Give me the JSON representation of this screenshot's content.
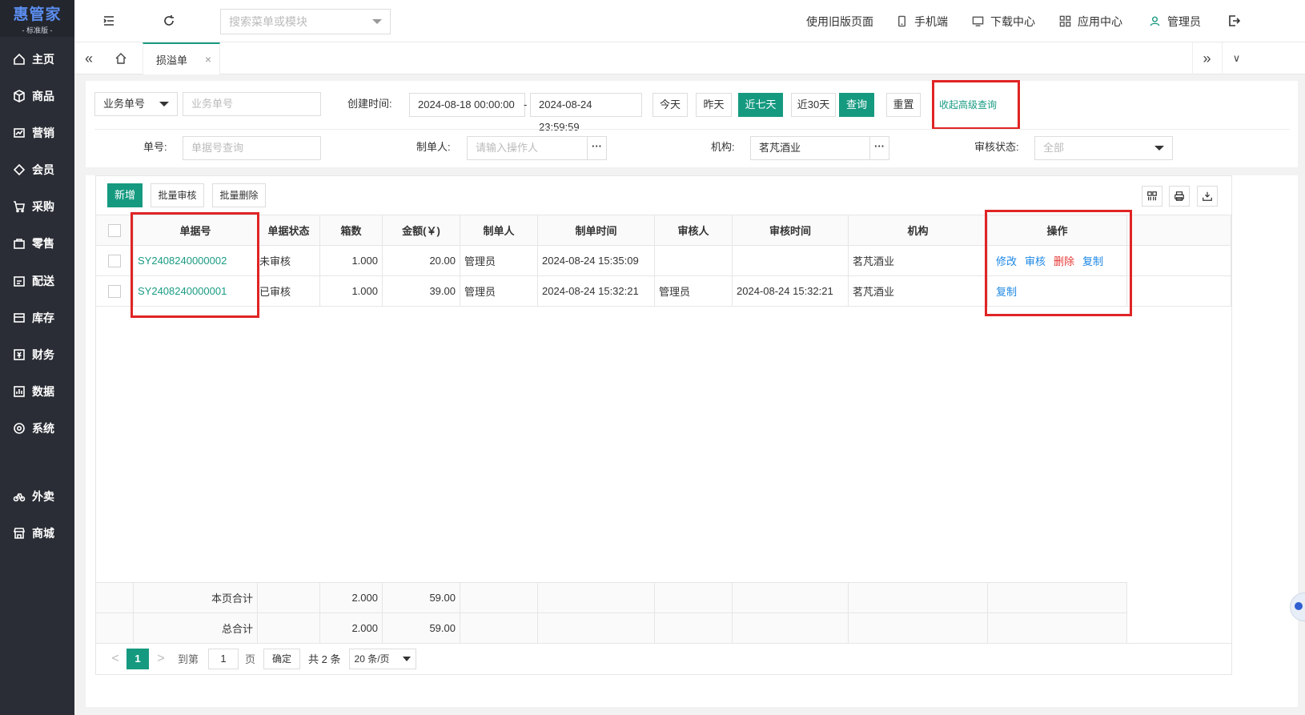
{
  "brand": {
    "name": "惠管家",
    "edition": "- 标准版 -"
  },
  "sidebar": {
    "items": [
      {
        "label": "主页"
      },
      {
        "label": "商品"
      },
      {
        "label": "营销"
      },
      {
        "label": "会员"
      },
      {
        "label": "采购"
      },
      {
        "label": "零售"
      },
      {
        "label": "配送"
      },
      {
        "label": "库存"
      },
      {
        "label": "财务"
      },
      {
        "label": "数据"
      },
      {
        "label": "系统"
      },
      {
        "label": "外卖"
      },
      {
        "label": "商城"
      }
    ]
  },
  "topbar": {
    "search_placeholder": "搜索菜单或模块",
    "old_page": "使用旧版页面",
    "mobile": "手机端",
    "download": "下载中心",
    "apps": "应用中心",
    "user": "管理员"
  },
  "tabs": {
    "active": "损溢单",
    "close": "×",
    "first": "«",
    "last": "»",
    "more": "∨"
  },
  "filters": {
    "type_select": "业务单号",
    "type_placeholder": "业务单号",
    "created_label": "创建时间:",
    "date_from": "2024-08-18 00:00:00",
    "date_sep": "-",
    "date_to": "2024-08-24 23:59:59",
    "btn_today": "今天",
    "btn_yesterday": "昨天",
    "btn_7days": "近七天",
    "btn_30days": "近30天",
    "btn_query": "查询",
    "btn_reset": "重置",
    "btn_collapse": "收起高级查询",
    "doc_no_label": "单号:",
    "doc_no_placeholder": "单据号查询",
    "maker_label": "制单人:",
    "maker_placeholder": "请输入操作人",
    "org_label": "机构:",
    "org_value": "茗芃酒业",
    "audit_label": "审核状态:",
    "audit_value": "全部",
    "more": "···"
  },
  "toolbar": {
    "add": "新增",
    "batch_audit": "批量审核",
    "batch_delete": "批量删除"
  },
  "table": {
    "headers": [
      "单据号",
      "单据状态",
      "箱数",
      "金额(￥)",
      "制单人",
      "制单时间",
      "审核人",
      "审核时间",
      "机构",
      "操作"
    ],
    "rows": [
      {
        "no": "SY2408240000002",
        "status": "未审核",
        "boxes": "1.000",
        "amount": "20.00",
        "maker": "管理员",
        "made_at": "2024-08-24 15:35:09",
        "auditor": "",
        "audited_at": "",
        "org": "茗芃酒业",
        "actions": [
          "修改",
          "审核",
          "删除",
          "复制"
        ]
      },
      {
        "no": "SY2408240000001",
        "status": "已审核",
        "boxes": "1.000",
        "amount": "39.00",
        "maker": "管理员",
        "made_at": "2024-08-24 15:32:21",
        "auditor": "管理员",
        "audited_at": "2024-08-24 15:32:21",
        "org": "茗芃酒业",
        "actions": [
          "复制"
        ]
      }
    ]
  },
  "summary": {
    "page_label": "本页合计",
    "page_boxes": "2.000",
    "page_amount": "59.00",
    "total_label": "总合计",
    "total_boxes": "2.000",
    "total_amount": "59.00"
  },
  "pager": {
    "prev": "<",
    "current": "1",
    "next": ">",
    "goto": "到第",
    "page_input": "1",
    "page_unit": "页",
    "confirm": "确定",
    "total": "共 2 条",
    "page_size": "20 条/页"
  },
  "colors": {
    "accent": "#159a80",
    "sidebar": "#2a2d35",
    "link_blue": "#1e88e5",
    "danger": "#e53935",
    "highlight": "#e02424"
  }
}
